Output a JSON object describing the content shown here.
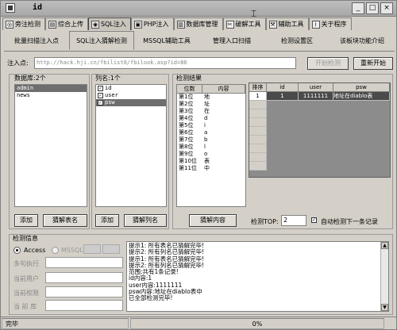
{
  "window": {
    "title": "id",
    "min": "_",
    "max": "□",
    "close": "×"
  },
  "top_tabs": [
    {
      "label": "旁注检测",
      "icon": "radar-icon"
    },
    {
      "label": "综合上传",
      "icon": "upload-icon"
    },
    {
      "label": "SQL注入",
      "icon": "sql-icon"
    },
    {
      "label": "PHP注入",
      "icon": "php-icon"
    },
    {
      "label": "数据库管理",
      "icon": "database-icon"
    },
    {
      "label": "破解工具",
      "icon": "crack-icon"
    },
    {
      "label": "辅助工具",
      "icon": "tools-icon"
    },
    {
      "label": "关于程序",
      "icon": "info-icon"
    }
  ],
  "sub_tabs": [
    "批量扫描注入点",
    "SQL注入猜解检测",
    "MSSQL辅助工具",
    "管理入口扫描",
    "检测设置区",
    "该板块功能介绍"
  ],
  "inject": {
    "label": "注入点:",
    "value": "http://hack.hji.cn/fbilist0/fbilook.asp?id=86",
    "start_btn": "开始检测",
    "restart_btn": "重新开始"
  },
  "database_panel": {
    "title": "数据库:2个",
    "items": [
      "admin",
      "news"
    ],
    "add_btn": "添加",
    "guess_btn": "猜解表名"
  },
  "column_panel": {
    "title": "列名:1个",
    "items": [
      "id",
      "user",
      "psw"
    ],
    "add_btn": "添加",
    "guess_btn": "猜解列名"
  },
  "result_panel": {
    "title": "检测结果",
    "headers": [
      "位数",
      "内容"
    ],
    "rows": [
      [
        "第1位",
        "地"
      ],
      [
        "第2位",
        "址"
      ],
      [
        "第3位",
        "在"
      ],
      [
        "第4位",
        "d"
      ],
      [
        "第5位",
        "i"
      ],
      [
        "第6位",
        "a"
      ],
      [
        "第7位",
        "b"
      ],
      [
        "第8位",
        "l"
      ],
      [
        "第9位",
        "o"
      ],
      [
        "第10位",
        "表"
      ],
      [
        "第11位",
        "中"
      ]
    ],
    "guess_content_btn": "猜解内容"
  },
  "sql_grid": {
    "headers": [
      "排序",
      "id",
      "user",
      "psw"
    ],
    "rows": [
      [
        "1",
        "1",
        "1111111",
        "地址在diablo表"
      ]
    ]
  },
  "detect_top": {
    "label": "检测TOP:",
    "value": "2",
    "auto_label": "自动检测下一条记录"
  },
  "detect_info": {
    "title": "检测信息",
    "access": "Access",
    "mssql": "MSSQL",
    "fields": [
      "多句执行",
      "当前用户",
      "当前权限",
      "当 前 库"
    ]
  },
  "log": [
    "提示1: 所有表名已猜解完毕!",
    "提示2: 所有列名已猜解完毕!",
    "提示1: 所有表名已猜解完毕!",
    "提示2: 所有列名已猜解完毕!",
    "范围:共有1条记录!",
    "id内容:1",
    "user内容:1111111",
    "psw内容:地址在diablo表中",
    "已全部检测完毕!"
  ],
  "status": {
    "text": "完毕",
    "progress": "0%"
  }
}
